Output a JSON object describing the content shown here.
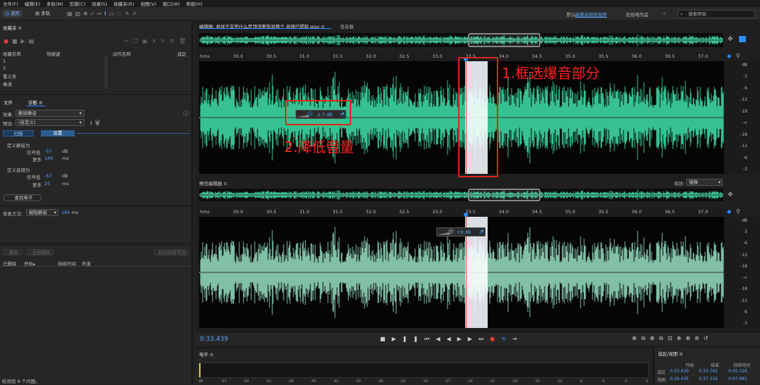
{
  "menu": [
    "文件(F)",
    "编辑(E)",
    "多轨(M)",
    "剪辑(C)",
    "效果(S)",
    "收藏夹(R)",
    "视图(V)",
    "窗口(W)",
    "帮助(H)"
  ],
  "toolbar": {
    "waveform_tab": "波形",
    "multitrack_tab": "多轨"
  },
  "workspaces": {
    "default": "默认",
    "active": "编辑音频到视频",
    "other": "无线电作品",
    "search_placeholder": "搜索帮助"
  },
  "favorites": {
    "title": "收藏夹",
    "headers": [
      "收藏名称",
      "快捷键",
      "动作名称",
      "选区"
    ],
    "items": [
      "1",
      "3",
      "重义务",
      "毒液"
    ]
  },
  "left_tabs": {
    "files": "文件",
    "diagnostics": "诊断"
  },
  "diagnostics": {
    "effect_label": "效果:",
    "effect_value": "删除静音",
    "preset_label": "预设:",
    "preset_value": "(自定义)",
    "scan_btn": "扫描",
    "settings_btn": "设置",
    "silence_title": "定义静音为",
    "sig_label": "信号低",
    "sig_value": "-57",
    "sig_unit": "dB",
    "more_label": "更多",
    "more_value": "140",
    "more_unit": "ms",
    "audio_title": "定义音频为",
    "sig2_value": "-57",
    "more2_value": "25",
    "find_level": "查找电平",
    "repair_label": "修复方法:",
    "repair_value": "缩短静音",
    "repair_ms": "165",
    "repair_unit": "ms",
    "delete_btn": "删除",
    "delete_all_btn": "全部删除",
    "mark_btn": "标记所有节点",
    "list_headers": [
      "已删除",
      "开始",
      "持续时间",
      "声道"
    ],
    "status": "检测到 6 个问题。"
  },
  "editor": {
    "tab_title": "编辑器: 易烊千玺凭什么是顶流要饭说两个 音频已提取.wav",
    "mixer_tab": "混音器",
    "preview_title": "预览编辑器",
    "zoom_label": "缩放:",
    "zoom_value": "镜像",
    "ruler_unit": "hms",
    "ruler_labels": [
      "30.0",
      "30.5",
      "31.0",
      "31.5",
      "32.0",
      "32.5",
      "33.0",
      "33.5",
      "34.0",
      "34.5",
      "35.0",
      "35.5",
      "36.0",
      "36.5",
      "37.0"
    ],
    "db_labels": [
      "dB",
      "-3",
      "-6",
      "-12",
      "-18",
      "-∞",
      "-18",
      "-12",
      "-6",
      "-3"
    ],
    "hud_top": "-2.7 dB",
    "hud_bottom": "+0 dB",
    "time_display": "0:33.439"
  },
  "levels": {
    "title": "电平",
    "scale": [
      "dB",
      "-57",
      "-54",
      "-51",
      "-48",
      "-45",
      "-42",
      "-39",
      "-36",
      "-33",
      "-30",
      "-27",
      "-24",
      "-21",
      "-18",
      "-15",
      "-12",
      "-9",
      "-6",
      "-3",
      "0"
    ]
  },
  "selection_view": {
    "title": "选区/视图",
    "headers": [
      "开始",
      "结束",
      "持续时间"
    ],
    "rows": [
      {
        "label": "选区",
        "start": "0:33.439",
        "end": "0:33.765",
        "dur": "0:00.326"
      },
      {
        "label": "视图",
        "start": "0:29.435",
        "end": "0:37.316",
        "dur": "0:07.881"
      }
    ]
  },
  "annotations": {
    "step1": "1.框选爆音部分",
    "step2": "2.降低音量"
  },
  "colors": {
    "wave_top": "#3ed6a0",
    "wave_bottom": "#8fd4b8",
    "annotation": "#ff2020",
    "accent": "#2d8cff",
    "record": "#e53935"
  }
}
